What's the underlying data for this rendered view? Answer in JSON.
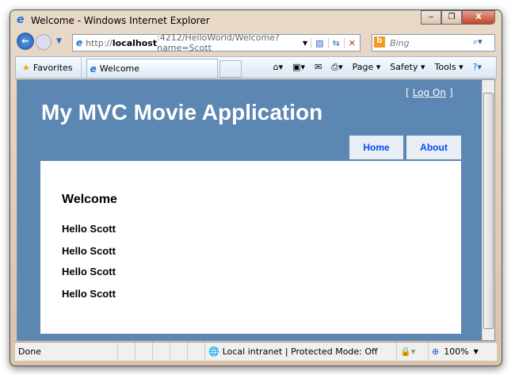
{
  "window": {
    "title": "Welcome - Windows Internet Explorer",
    "minimize": "‒",
    "restore": "❐",
    "close": "X"
  },
  "address": {
    "prefix": "http://",
    "host": "localhost",
    "rest": ":4212/HelloWorld/Welcome?name=Scott"
  },
  "search": {
    "placeholder": "Bing"
  },
  "toolbar": {
    "favorites": "Favorites",
    "tab": "Welcome",
    "page": "Page ▾",
    "safety": "Safety ▾",
    "tools": "Tools ▾"
  },
  "page": {
    "app_title": "My MVC Movie Application",
    "logon": "Log On",
    "bracket_open": "[",
    "bracket_close": "]",
    "menu": [
      "Home",
      "About"
    ],
    "heading": "Welcome",
    "messages": [
      "Hello Scott",
      "Hello Scott",
      "Hello Scott",
      "Hello Scott"
    ]
  },
  "status": {
    "text": "Done",
    "zone": "Local intranet | Protected Mode: Off",
    "zoom": "100%"
  }
}
